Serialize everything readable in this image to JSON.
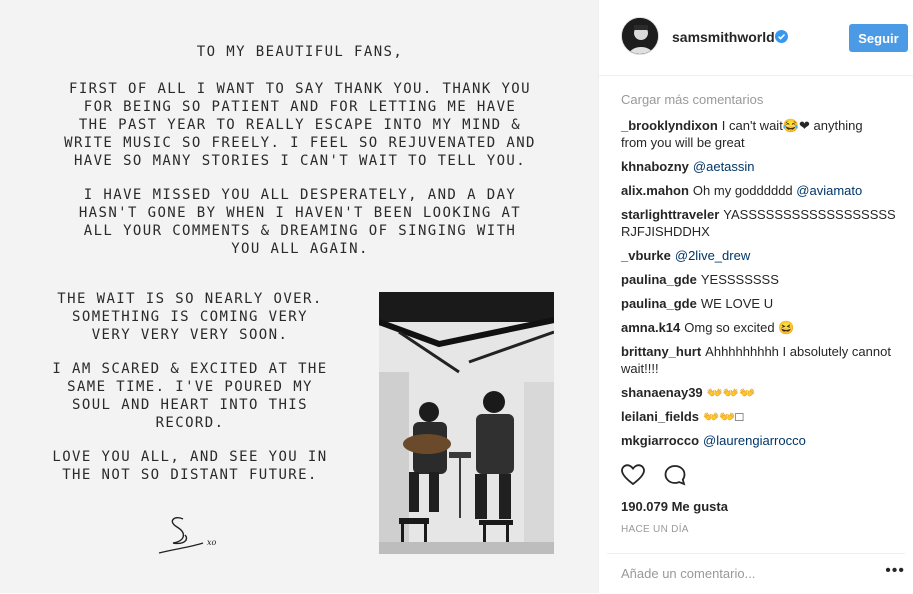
{
  "post": {
    "letter_title": "To my beautiful fans,",
    "letter_p1": "First of all I want to say thank you. Thank you\nfor being so patient and for letting me have\nthe past year to really escape into my mind &\nwrite music so freely. I feel so rejuvenated and\nhave so many stories I can't wait to tell you.",
    "letter_p2": "I have missed you all desperately, and a day\nhasn't gone by when I haven't been looking at\nall your comments & dreaming of singing with\nyou all again.",
    "letter_p3": "The wait is so nearly over.\nSomething is coming very\nvery very very soon.",
    "letter_p4": "I am scared & excited at the\nsame time. I've poured my\nsoul and heart into this\nrecord.",
    "letter_p5": "Love you all, and see you in\nthe not so distant future.",
    "signature_suffix": "xo"
  },
  "header": {
    "username": "samsmithworld",
    "follow_label": "Seguir"
  },
  "load_more": "Cargar más comentarios",
  "comments": [
    {
      "user": "_brooklyndixon",
      "text": "I can't wait😂❤ anything from you will be great",
      "mention": ""
    },
    {
      "user": "khnabozny",
      "text": "",
      "mention": "@aetassin"
    },
    {
      "user": "alix.mahon",
      "text": "Oh my godddddd",
      "mention": "@aviamato"
    },
    {
      "user": "starlighttraveler",
      "text": "YASSSSSSSSSSSSSSSSSS RJFJISHDDHX",
      "mention": ""
    },
    {
      "user": "_vburke",
      "text": "",
      "mention": "@2live_drew"
    },
    {
      "user": "paulina_gde",
      "text": "YESSSSSSS",
      "mention": ""
    },
    {
      "user": "paulina_gde",
      "text": "WE LOVE U",
      "mention": ""
    },
    {
      "user": "amna.k14",
      "text": "Omg so excited 😆",
      "mention": ""
    },
    {
      "user": "brittany_hurt",
      "text": "Ahhhhhhhhh I absolutely cannot wait!!!!",
      "mention": ""
    },
    {
      "user": "shanaenay39",
      "text": "👐👐👐",
      "mention": ""
    },
    {
      "user": "leilani_fields",
      "text": "👐👐□",
      "mention": ""
    },
    {
      "user": "mkgiarrocco",
      "text": "",
      "mention": "@laurengiarrocco"
    }
  ],
  "likes": "190.079 Me gusta",
  "time": "HACE UN DÍA",
  "add_comment_placeholder": "Añade un comentario...",
  "more_options": "•••",
  "icons": {
    "like": "heart-icon",
    "comment": "comment-bubble-icon",
    "verified": "verified-badge-icon",
    "more": "more-options-icon"
  },
  "colors": {
    "follow_button": "#4a9ae6",
    "mention": "#003569",
    "verified": "#3897f0",
    "muted_text": "#999999"
  }
}
